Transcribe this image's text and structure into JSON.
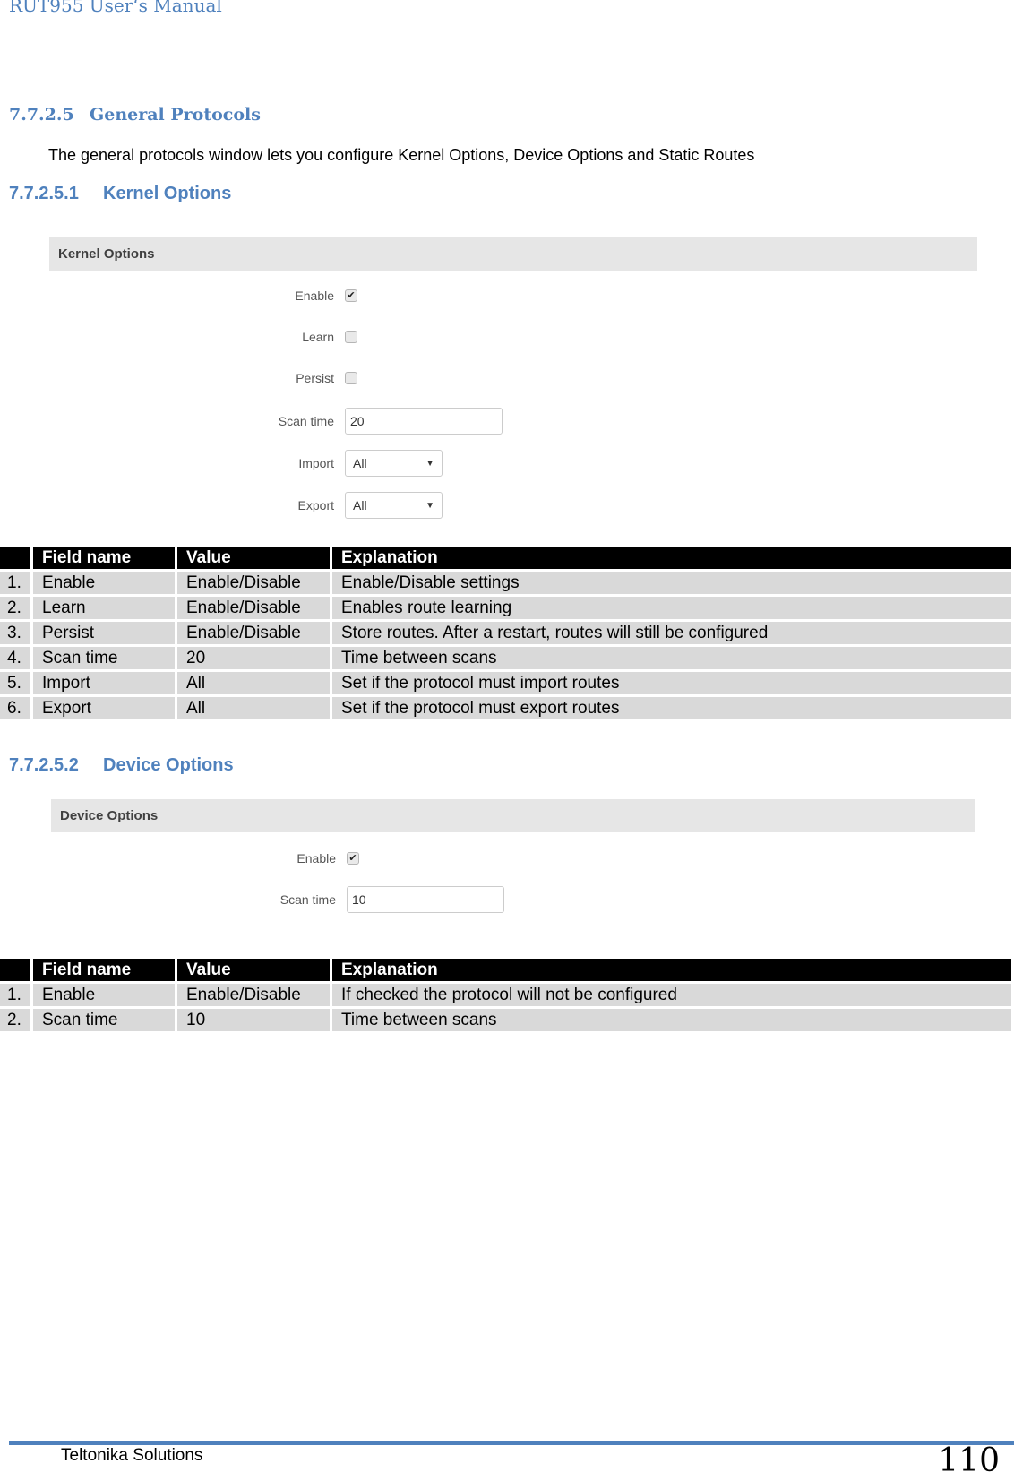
{
  "document": {
    "running_header": "RUT955 User‘s Manual",
    "section": {
      "number": "7.7.2.5",
      "title": "General Protocols"
    },
    "intro": "The general protocols window lets you configure Kernel Options, Device Options and Static Routes",
    "kernel": {
      "number": "7.7.2.5.1",
      "title": "Kernel Options",
      "panel": {
        "header": "Kernel Options",
        "fields": {
          "enable": {
            "label": "Enable",
            "checked": true,
            "check_glyph": "✔"
          },
          "learn": {
            "label": "Learn",
            "checked": false
          },
          "persist": {
            "label": "Persist",
            "checked": false
          },
          "scan_time": {
            "label": "Scan time",
            "value": "20"
          },
          "import": {
            "label": "Import",
            "value": "All",
            "arrow": "▼"
          },
          "export": {
            "label": "Export",
            "value": "All",
            "arrow": "▼"
          }
        }
      },
      "table": {
        "headers": [
          "",
          "Field name",
          "Value",
          "Explanation"
        ],
        "rows": [
          [
            "1.",
            "Enable",
            "Enable/Disable",
            "Enable/Disable settings"
          ],
          [
            "2.",
            "Learn",
            "Enable/Disable",
            "Enables route learning"
          ],
          [
            "3.",
            "Persist",
            "Enable/Disable",
            "Store routes. After a restart, routes will still be configured"
          ],
          [
            "4.",
            "Scan time",
            "20",
            "Time between scans"
          ],
          [
            "5.",
            "Import",
            "All",
            "Set if the protocol must import routes"
          ],
          [
            "6.",
            "Export",
            "All",
            "Set if the protocol must export routes"
          ]
        ]
      }
    },
    "device": {
      "number": "7.7.2.5.2",
      "title": "Device Options",
      "panel": {
        "header": "Device Options",
        "fields": {
          "enable": {
            "label": "Enable",
            "checked": true,
            "check_glyph": "✔"
          },
          "scan_time": {
            "label": "Scan time",
            "value": "10"
          }
        }
      },
      "table": {
        "headers": [
          "",
          "Field name",
          "Value",
          "Explanation"
        ],
        "rows": [
          [
            "1.",
            "Enable",
            "Enable/Disable",
            "If checked the protocol will not be configured"
          ],
          [
            "2.",
            "Scan time",
            "10",
            "Time between scans"
          ]
        ]
      }
    },
    "footer": {
      "company": "Teltonika Solutions",
      "page_number": "110"
    },
    "colors": {
      "heading_blue": "#4f81bd",
      "table_header_bg": "#000000",
      "table_cell_bg": "#d9d9d9",
      "panel_header_bg": "#e6e6e6"
    }
  }
}
